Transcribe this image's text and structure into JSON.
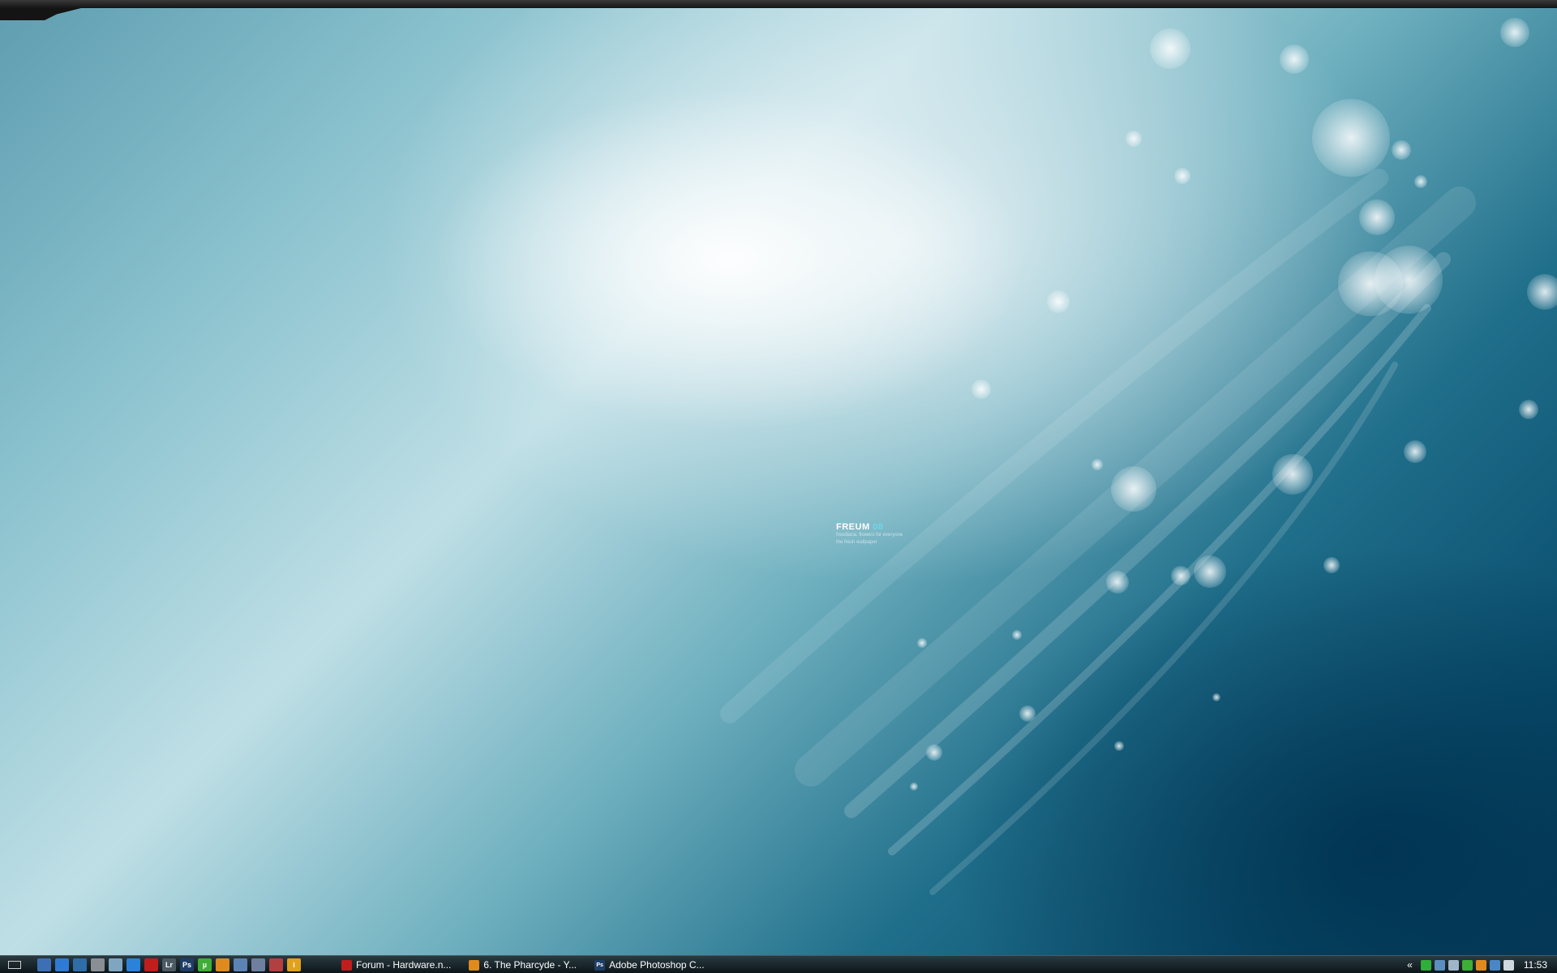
{
  "wallpaper": {
    "title": "FREUM",
    "year": "08",
    "subtitle_lines": [
      "freudiana. flowers for everyone",
      "the fresh wallpaper"
    ]
  },
  "quick_launch": [
    {
      "name": "show-desktop-icon"
    },
    {
      "name": "computer-icon",
      "color": "#3d6fb6"
    },
    {
      "name": "window-icon",
      "color": "#2e7bd6"
    },
    {
      "name": "screen-icon",
      "color": "#2f6da8"
    },
    {
      "name": "tools-icon",
      "color": "#8a8f96"
    },
    {
      "name": "recycle-bin-icon",
      "color": "#7fa6c0"
    },
    {
      "name": "internet-explorer-icon",
      "color": "#2a83d9"
    },
    {
      "name": "opera-icon",
      "color": "#c21d1d"
    },
    {
      "name": "lightroom-icon",
      "color": "#4c5a63",
      "label": "Lr"
    },
    {
      "name": "photoshop-icon",
      "color": "#1f3e66",
      "label": "Ps"
    },
    {
      "name": "utorrent-icon",
      "color": "#3fae36",
      "label": "µ"
    },
    {
      "name": "firefox-icon",
      "color": "#e08a1e"
    },
    {
      "name": "network-icon",
      "color": "#5b83b5"
    },
    {
      "name": "grid-icon",
      "color": "#6f7fa0"
    },
    {
      "name": "virus-icon",
      "color": "#b34040"
    },
    {
      "name": "info-icon",
      "color": "#e0a11d",
      "label": "i"
    }
  ],
  "tasks": [
    {
      "name": "task-forum",
      "label": "Forum - Hardware.n...",
      "icon": "opera-icon",
      "color": "#c21d1d"
    },
    {
      "name": "task-pharcyde",
      "label": "6. The Pharcyde - Y...",
      "icon": "firefox-icon",
      "color": "#e08a1e"
    },
    {
      "name": "task-photoshop",
      "label": "Adobe Photoshop C...",
      "icon": "photoshop-icon",
      "color": "#1f3e66",
      "label_icon": "Ps"
    }
  ],
  "tray": {
    "expand_label": "«",
    "icons": [
      {
        "name": "media-play-icon",
        "color": "#2fae3a"
      },
      {
        "name": "network-monitor-icon",
        "color": "#5a8fc0"
      },
      {
        "name": "messenger-icon",
        "color": "#9fb5c8"
      },
      {
        "name": "utorrent-tray-icon",
        "color": "#3fae36"
      },
      {
        "name": "firefox-tray-icon",
        "color": "#e08a1e"
      },
      {
        "name": "network-icon",
        "color": "#4a86c6"
      },
      {
        "name": "volume-icon",
        "color": "#cfd8de"
      }
    ],
    "clock": "11:53"
  }
}
